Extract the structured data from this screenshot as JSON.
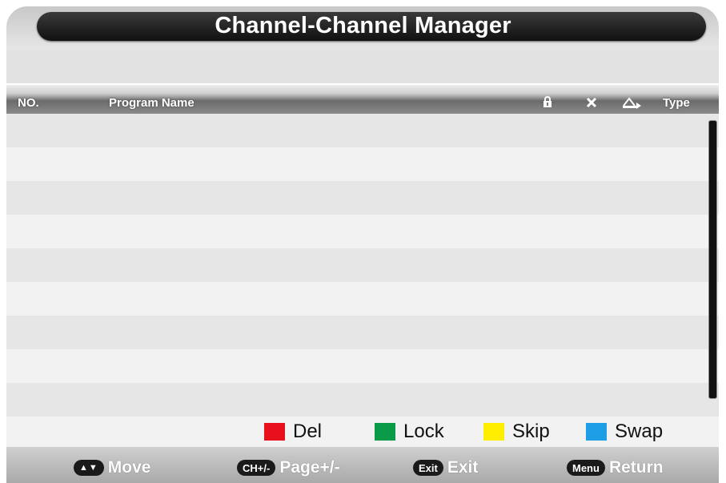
{
  "title": "Channel-Channel Manager",
  "columns": {
    "no": "NO.",
    "program_name": "Program Name",
    "lock_icon": "lock-icon",
    "skip_icon": "skip-icon",
    "swap_icon": "swap-icon",
    "type": "Type"
  },
  "rows": [],
  "legend": {
    "del": {
      "label": "Del",
      "color": "#e8101c"
    },
    "lock": {
      "label": "Lock",
      "color": "#0a9a48"
    },
    "skip": {
      "label": "Skip",
      "color": "#ffee00"
    },
    "swap": {
      "label": "Swap",
      "color": "#1d9ee5"
    }
  },
  "nav": {
    "move": {
      "key": "▲▼",
      "label": "Move"
    },
    "page": {
      "key": "CH+/-",
      "label": "Page+/-"
    },
    "exit": {
      "key": "Exit",
      "label": "Exit"
    },
    "return": {
      "key": "Menu",
      "label": "Return"
    }
  }
}
